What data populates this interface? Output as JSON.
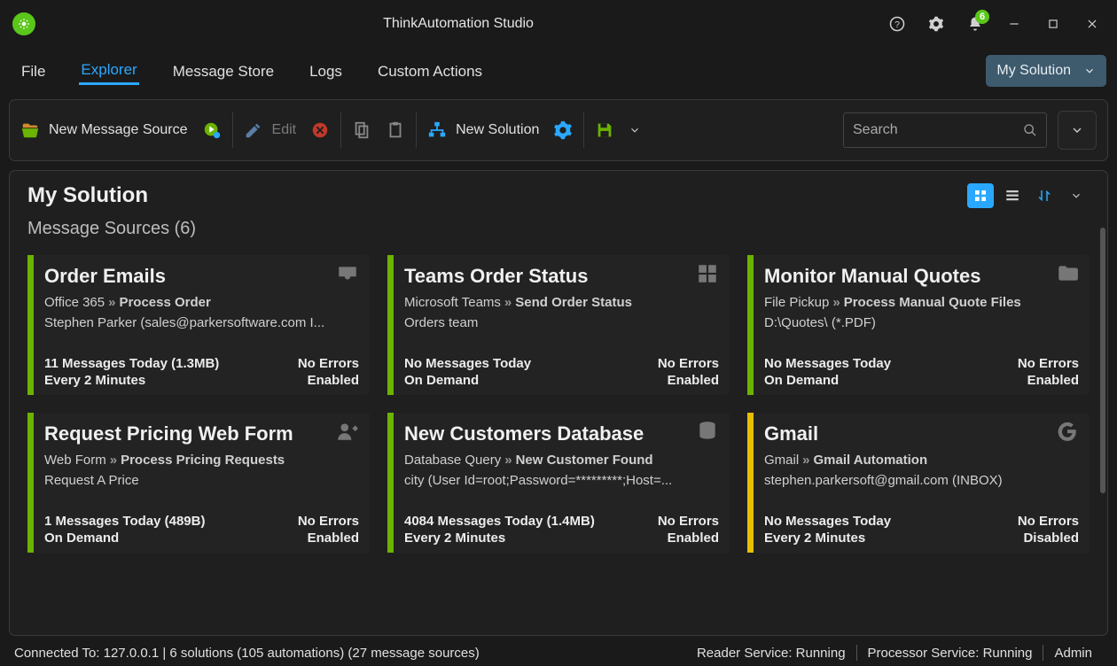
{
  "titlebar": {
    "title": "ThinkAutomation Studio",
    "notification_count": "6"
  },
  "menubar": {
    "items": [
      {
        "label": "File"
      },
      {
        "label": "Explorer",
        "active": true
      },
      {
        "label": "Message Store"
      },
      {
        "label": "Logs"
      },
      {
        "label": "Custom Actions"
      }
    ],
    "solution_dropdown": "My Solution"
  },
  "toolbar": {
    "new_message_source": "New Message Source",
    "edit": "Edit",
    "new_solution": "New Solution",
    "search_placeholder": "Search"
  },
  "panel": {
    "title": "My Solution",
    "subtitle": "Message Sources (6)"
  },
  "tiles": [
    {
      "title": "Order Emails",
      "icon": "inbox",
      "source_type": "Office 365",
      "automation": "Process Order",
      "detail": "Stephen Parker (sales@parkersoftware.com I...",
      "messages": "11 Messages Today (1.3MB)",
      "errors": "No Errors",
      "schedule": "Every 2 Minutes",
      "state": "Enabled",
      "bar": "green"
    },
    {
      "title": "Teams Order Status",
      "icon": "grid",
      "source_type": "Microsoft Teams",
      "automation": "Send Order Status",
      "detail": "Orders team",
      "messages": "No Messages Today",
      "errors": "No Errors",
      "schedule": "On Demand",
      "state": "Enabled",
      "bar": "green"
    },
    {
      "title": "Monitor Manual Quotes",
      "icon": "folder",
      "source_type": "File Pickup",
      "automation": "Process Manual Quote Files",
      "detail": "D:\\Quotes\\ (*.PDF)",
      "messages": "No Messages Today",
      "errors": "No Errors",
      "schedule": "On Demand",
      "state": "Enabled",
      "bar": "green"
    },
    {
      "title": "Request Pricing Web Form",
      "icon": "userform",
      "source_type": "Web Form",
      "automation": "Process Pricing Requests",
      "detail": "Request A Price",
      "messages": "1 Messages Today (489B)",
      "errors": "No Errors",
      "schedule": "On Demand",
      "state": "Enabled",
      "bar": "green"
    },
    {
      "title": "New Customers Database",
      "icon": "database",
      "source_type": "Database Query",
      "automation": "New Customer Found",
      "detail": "city (User Id=root;Password=*********;Host=...",
      "messages": "4084 Messages Today (1.4MB)",
      "errors": "No Errors",
      "schedule": "Every 2 Minutes",
      "state": "Enabled",
      "bar": "green"
    },
    {
      "title": "Gmail",
      "icon": "g",
      "source_type": "Gmail",
      "automation": "Gmail Automation",
      "detail": "stephen.parkersoft@gmail.com (INBOX)",
      "messages": "No Messages Today",
      "errors": "No Errors",
      "schedule": "Every 2 Minutes",
      "state": "Disabled",
      "bar": "yellow"
    }
  ],
  "statusbar": {
    "connected": "Connected To: 127.0.0.1 | 6 solutions (105 automations) (27 message sources)",
    "reader": "Reader Service: Running",
    "processor": "Processor Service: Running",
    "user": "Admin"
  }
}
